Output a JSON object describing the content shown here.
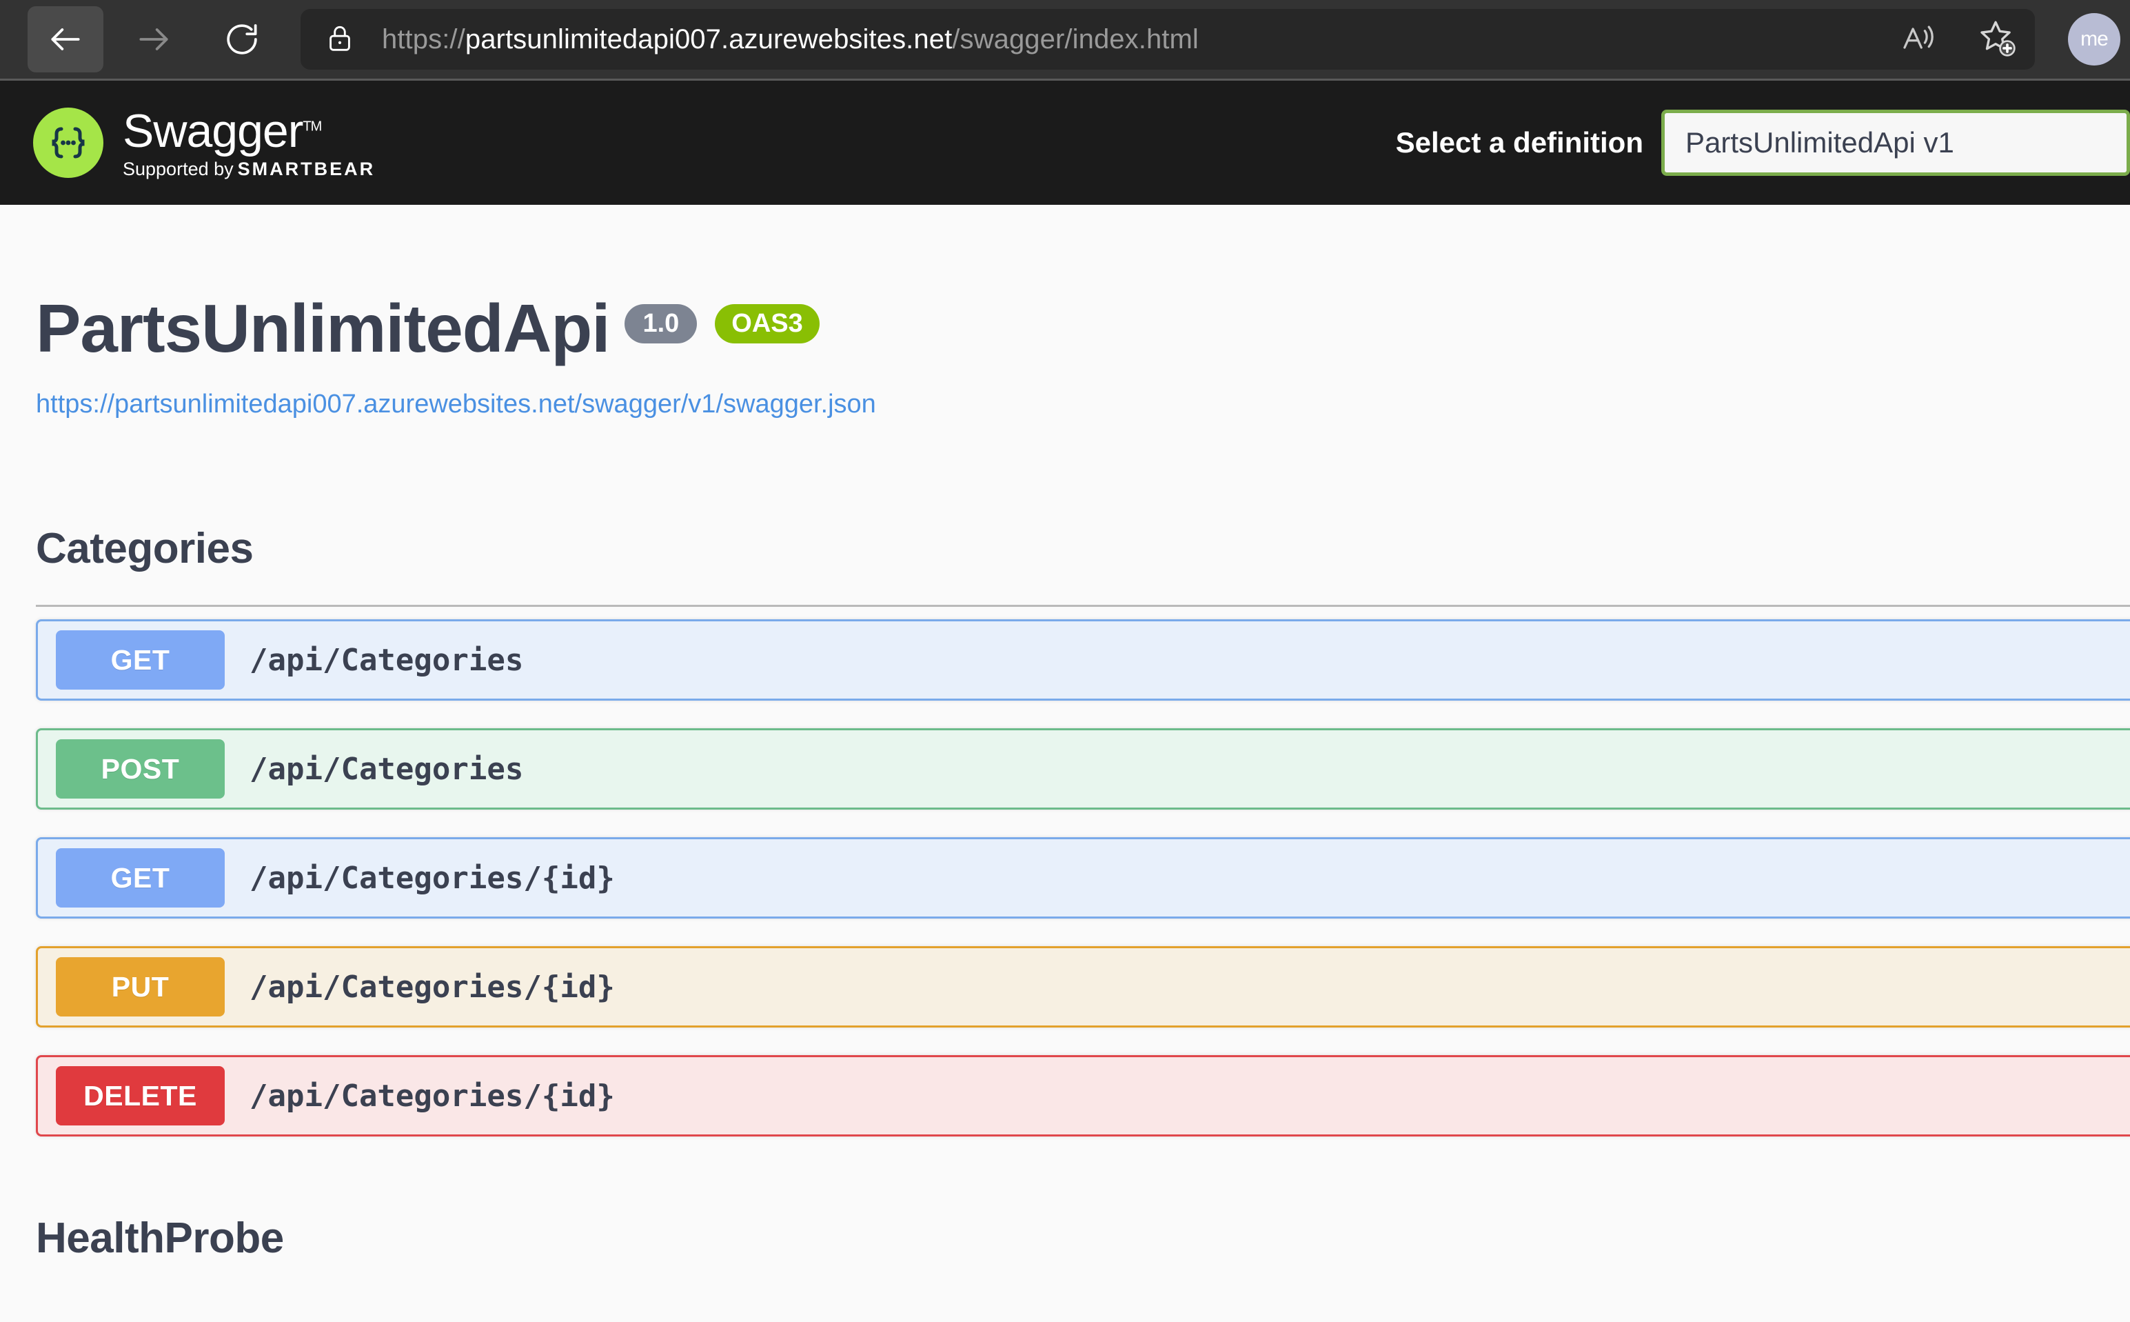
{
  "browser": {
    "back_icon": "arrow-left-icon",
    "forward_icon": "arrow-right-icon",
    "reload_icon": "reload-icon",
    "lock_icon": "lock-icon",
    "url_scheme": "https://",
    "url_host": "partsunlimitedapi007.azurewebsites.net",
    "url_path": "/swagger/index.html",
    "read_aloud_icon": "read-aloud-icon",
    "favorite_icon": "add-favorite-star-icon",
    "profile_initials": "me"
  },
  "topbar": {
    "logo_icon": "swagger-braces-logo-icon",
    "brand": "Swagger",
    "trademark": "TM",
    "supported_by_prefix": "Supported by",
    "supported_by_brand": "SMARTBEAR",
    "definition_label": "Select a definition",
    "definition_selected": "PartsUnlimitedApi v1"
  },
  "info": {
    "title": "PartsUnlimitedApi",
    "version_badge": "1.0",
    "spec_badge": "OAS3",
    "spec_url": "https://partsunlimitedapi007.azurewebsites.net/swagger/v1/swagger.json"
  },
  "sections": [
    {
      "name": "Categories",
      "operations": [
        {
          "method": "GET",
          "path": "/api/Categories"
        },
        {
          "method": "POST",
          "path": "/api/Categories"
        },
        {
          "method": "GET",
          "path": "/api/Categories/{id}"
        },
        {
          "method": "PUT",
          "path": "/api/Categories/{id}"
        },
        {
          "method": "DELETE",
          "path": "/api/Categories/{id}"
        }
      ]
    },
    {
      "name": "HealthProbe",
      "operations": []
    }
  ],
  "colors": {
    "get": "#7fa9f5",
    "post": "#6cc08b",
    "put": "#e8a52f",
    "delete": "#e03a3e",
    "oas_badge": "#89bf04",
    "version_badge": "#7d8492",
    "link": "#4a90e2",
    "text": "#3b4151",
    "topbar_bg": "#1b1b1b",
    "page_bg": "#fafafa"
  }
}
